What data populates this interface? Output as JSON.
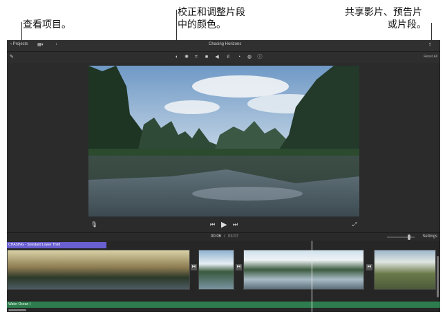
{
  "callouts": {
    "view_projects": "查看项目。",
    "adjust_color_line1": "校正和调整片段",
    "adjust_color_line2": "中的颜色。",
    "share_line1": "共享影片、预告片",
    "share_line2": "或片段。"
  },
  "topbar": {
    "back_label": "Projects",
    "project_title": "Chasing Horizons"
  },
  "toolbar": {
    "reset_all": "Reset All",
    "tools": [
      "magic-wand-icon",
      "color-balance-icon",
      "color-correction-icon",
      "crop-icon",
      "stabilization-icon",
      "volume-icon",
      "equalizer-icon",
      "speed-icon",
      "noise-reduction-icon",
      "info-icon"
    ]
  },
  "playback": {
    "current_time": "00:06",
    "separator": "/",
    "total_time": "03:07",
    "settings_label": "Settings"
  },
  "timeline": {
    "title_clip_label": "CHASING - Standard Lower Third",
    "audio_label": "Water Ocean I",
    "transition_glyph": "⧓"
  }
}
